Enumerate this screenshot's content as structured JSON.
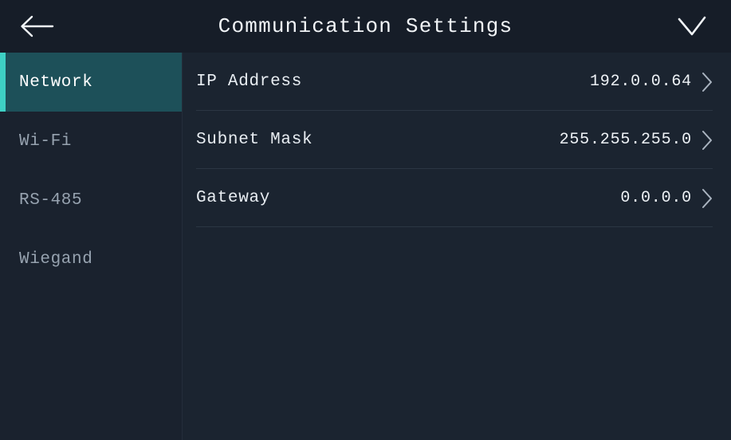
{
  "header": {
    "title": "Communication Settings",
    "back_icon": "back-arrow-icon",
    "confirm_icon": "check-icon"
  },
  "sidebar": {
    "items": [
      {
        "label": "Network",
        "selected": true
      },
      {
        "label": "Wi-Fi",
        "selected": false
      },
      {
        "label": "RS-485",
        "selected": false
      },
      {
        "label": "Wiegand",
        "selected": false
      }
    ]
  },
  "main": {
    "rows": [
      {
        "label": "IP Address",
        "value": "192.0.0.64",
        "chevron_icon": "chevron-right-icon"
      },
      {
        "label": "Subnet Mask",
        "value": "255.255.255.0",
        "chevron_icon": "chevron-right-icon"
      },
      {
        "label": "Gateway",
        "value": "0.0.0.0",
        "chevron_icon": "chevron-right-icon"
      }
    ]
  },
  "colors": {
    "background": "#1b2430",
    "header_background": "#161d28",
    "sidebar_background": "#1a222e",
    "accent": "#3ed0c4",
    "selected_row": "#1d5059",
    "text_primary": "#eef2f6",
    "text_muted": "#97a3b0",
    "divider": "#2b3643"
  }
}
